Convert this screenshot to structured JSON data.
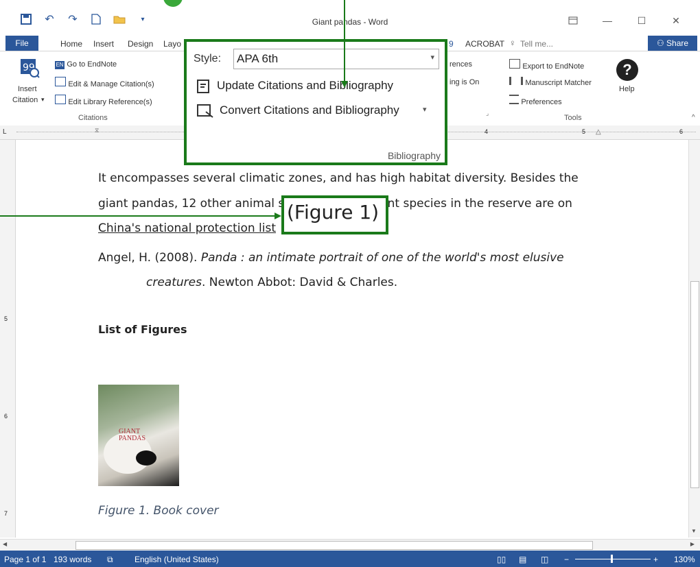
{
  "window": {
    "title": "Giant pandas - Word"
  },
  "tabs": {
    "file": "File",
    "home": "Home",
    "insert": "Insert",
    "design": "Design",
    "layout": "Layo",
    "endnote_fragment": "9",
    "acrobat": "ACROBAT",
    "tell_me": "Tell me...",
    "share": "Share"
  },
  "ribbon": {
    "insert_citation": "Insert\nCitation",
    "insert_citation_line1": "Insert",
    "insert_citation_line2": "Citation",
    "go_to_endnote": "Go to EndNote",
    "edit_manage": "Edit & Manage Citation(s)",
    "edit_library": "Edit Library Reference(s)",
    "citations_group": "Citations",
    "references_fragment": "rences",
    "instant_fragment": "ing is On",
    "export_endnote": "Export to EndNote",
    "manuscript_matcher": "Manuscript Matcher",
    "preferences": "Preferences",
    "help": "Help",
    "tools_group": "Tools"
  },
  "style_panel": {
    "style_label": "Style:",
    "style_value": "APA 6th",
    "update_label": "Update Citations and Bibliography",
    "convert_label": "Convert Citations and Bibliography",
    "group_label": "Bibliography"
  },
  "ruler": {
    "n4": "4",
    "n5": "5",
    "n6": "6"
  },
  "vruler": {
    "n5": "5",
    "n6": "6",
    "n7": "7"
  },
  "document": {
    "line1": "It encompasses several climatic zones, and has high habitat diversity.    Besides the",
    "line2": "giant pandas, 12 other animal species and 47 plant species in the reserve are on",
    "line3": "China's national protection list",
    "figure_citation": "(Figure 1)",
    "ref_author": "Angel, H. (2008). ",
    "ref_title_1": "Panda : an intimate portrait of one of the world's most elusive",
    "ref_title_2": "creatures",
    "ref_tail": ". Newton Abbot: David & Charles.",
    "list_heading": "List of Figures",
    "cover_text": "GIANT PANDAS",
    "caption": "Figure 1. Book cover"
  },
  "status": {
    "page": "Page 1 of 1",
    "words": "193 words",
    "language": "English (United States)",
    "zoom": "130%"
  },
  "colors": {
    "accent": "#2b579a",
    "callout": "#1a7a1a"
  }
}
